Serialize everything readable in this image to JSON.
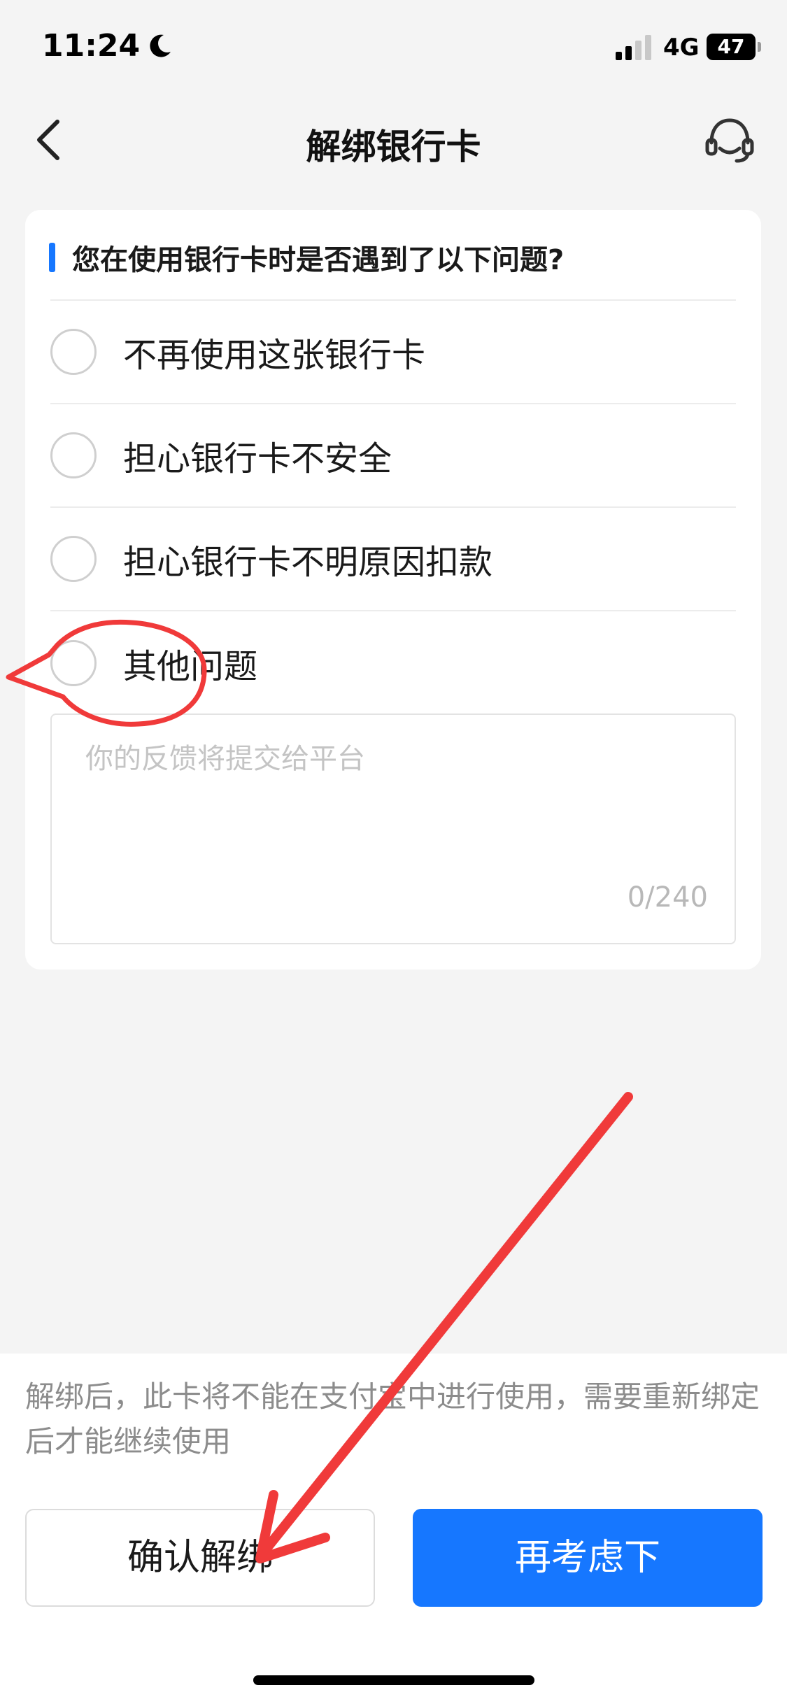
{
  "status_bar": {
    "time": "11:24",
    "network": "4G",
    "battery": "47"
  },
  "nav": {
    "title": "解绑银行卡"
  },
  "question": "您在使用银行卡时是否遇到了以下问题?",
  "options": [
    {
      "label": "不再使用这张银行卡"
    },
    {
      "label": "担心银行卡不安全"
    },
    {
      "label": "担心银行卡不明原因扣款"
    },
    {
      "label": "其他问题"
    }
  ],
  "feedback": {
    "placeholder": "你的反馈将提交给平台",
    "counter": "0/240"
  },
  "notice": "解绑后，此卡将不能在支付宝中进行使用，需要重新绑定后才能继续使用",
  "buttons": {
    "confirm": "确认解绑",
    "reconsider": "再考虑下"
  },
  "colors": {
    "accent": "#1677ff",
    "annotation": "#f03a3a",
    "background": "#f4f4f4"
  },
  "icons": [
    "moon-icon",
    "signal-icon",
    "battery-icon",
    "back-arrow-icon",
    "customer-service-icon"
  ]
}
